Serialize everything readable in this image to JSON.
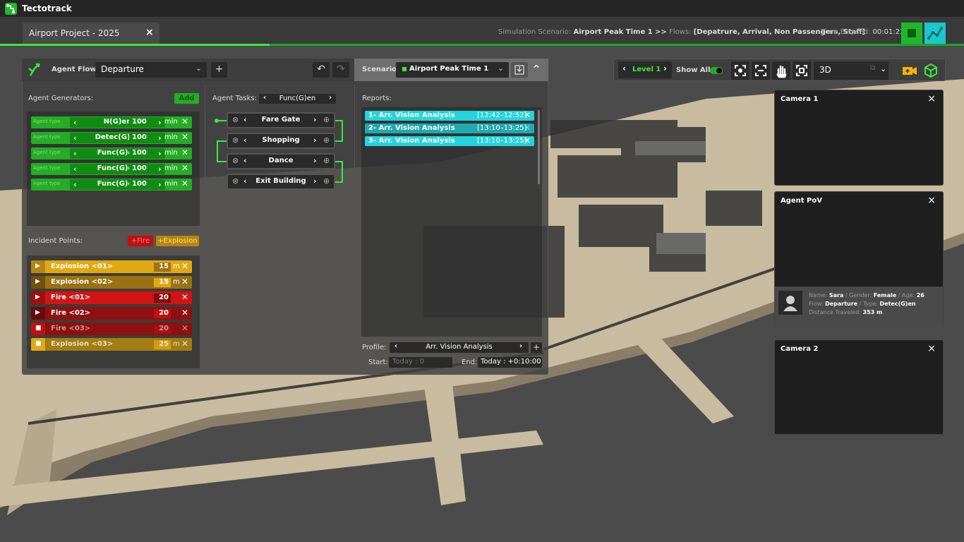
{
  "app": {
    "title": "Tectotrack"
  },
  "tab": {
    "title": "Airport Project - 2025",
    "close": "×"
  },
  "info": {
    "scenario_label": "Simulation Scenario:",
    "scenario": "Airport Peak Time 1 >>",
    "flows_label": "Flows:",
    "flows": "[Depatrure, Arrival, Non Passengers, Staff]",
    "elapsed_label": "Time Elapsed:",
    "elapsed": "00:01:23"
  },
  "progress": {
    "fraction": 0.28
  },
  "toolbar": {
    "agent_flow_label": "Agent Flow:",
    "agent_flow": "Departure",
    "add": "+",
    "undo": "↶",
    "redo": "↷",
    "scenario_label": "Scenario:",
    "scenario": "Airport Peak Time 1",
    "collapse": "^"
  },
  "generators": {
    "label": "Agent Generators:",
    "add": "Add",
    "items": [
      {
        "type": "Agent type",
        "name": "N(G)en",
        "value": "100",
        "unit": "min"
      },
      {
        "type": "Agent type",
        "name": "Detec(G)en",
        "value": "100",
        "unit": "min"
      },
      {
        "type": "Agent type",
        "name": "Func(G)en",
        "value": "100",
        "unit": "min"
      },
      {
        "type": "Agent type",
        "name": "Func(G)en",
        "value": "100",
        "unit": "min"
      },
      {
        "type": "Agent type",
        "name": "Func(G)en",
        "value": "100",
        "unit": "min"
      }
    ]
  },
  "incidents": {
    "label": "Incident Points:",
    "add_fire": "+Fire",
    "add_explosion": "+Explosion",
    "items": [
      {
        "name": "Explosion <01>",
        "value": "15",
        "unit": "m"
      },
      {
        "name": "Explosion <02>",
        "value": "15",
        "unit": "m"
      },
      {
        "name": "Fire <01>",
        "value": "20",
        "unit": ""
      },
      {
        "name": "Fire <02>",
        "value": "20",
        "unit": ""
      },
      {
        "name": "Fire <03>",
        "value": "20",
        "unit": ""
      },
      {
        "name": "Explosion <03>",
        "value": "25",
        "unit": "m"
      }
    ]
  },
  "tasks": {
    "label": "Agent Tasks:",
    "generator": "Func(G)en",
    "items": [
      "Fare Gate",
      "Shopping",
      "Dance",
      "Exit Building"
    ]
  },
  "reports": {
    "label": "Reports:",
    "items": [
      {
        "name": "1- Arr. Vision Analysis",
        "time": "[12:42–12:52]"
      },
      {
        "name": "2- Arr. Vision Analysis",
        "time": "[13:10–13:25]"
      },
      {
        "name": "3- Arr. Vision Analysis",
        "time": "[13:10–13:25]"
      }
    ],
    "profile_label": "Profile:",
    "profile": "Arr. Vision Analysis",
    "start_label": "Start:",
    "start_placeholder": "Today : 0",
    "end_label": "End:",
    "end_value": "Today : +0:10:00"
  },
  "right_toolbar": {
    "level": "Level 1",
    "show_all": "Show All:",
    "view": "3D"
  },
  "cameras": [
    {
      "title": "Camera 1"
    },
    {
      "title": "Agent PoV"
    },
    {
      "title": "Camera 2"
    }
  ],
  "agent": {
    "name_label": "Name:",
    "name": "Sara",
    "gender_label": "/ Gender:",
    "gender": "Female",
    "age_label": "/ Age:",
    "age": "26",
    "flow_label": "Flow:",
    "flow": "Departure",
    "type_label": "/ Type:",
    "type": "Detec(G)en",
    "dist_label": "Distance Traveled:",
    "dist": "353 m"
  },
  "colors": {
    "green": "#25ad25",
    "cyan": "#23d4dc",
    "explosion": "#e0a914",
    "fire": "#d21414"
  }
}
